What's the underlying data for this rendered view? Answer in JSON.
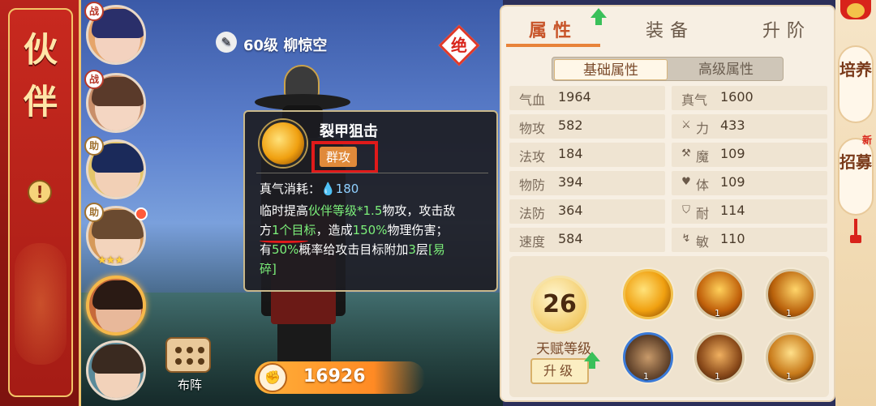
{
  "banner": {
    "title": "伙伴",
    "alert_icon": "exclamation-icon",
    "alert_text": "!"
  },
  "roster": [
    {
      "tag": "战",
      "tag_type": "battle",
      "hair": "#2a2f6a",
      "face": "#f3d2bf",
      "bg": "#e6a56a"
    },
    {
      "tag": "战",
      "tag_type": "battle",
      "hair": "#5a3a2a",
      "face": "#f4d6c2",
      "bg": "#c98f6a"
    },
    {
      "tag": "助",
      "tag_type": "assist",
      "hair": "#1b2a5a",
      "face": "#f2d0b6",
      "bg": "#e4c56a"
    },
    {
      "tag": "助",
      "tag_type": "assist",
      "hair": "#6a4a30",
      "face": "#f3d4bc",
      "bg": "#d69a5a",
      "red_dot": true,
      "stars": "★★★"
    },
    {
      "tag": "",
      "tag_type": "none",
      "hair": "#2a1a14",
      "face": "#e8b89a",
      "bg": "#c76a3a",
      "selected": true
    },
    {
      "tag": "",
      "tag_type": "none",
      "hair": "#3a2a20",
      "face": "#f2d2ba",
      "bg": "#5a8a9a"
    }
  ],
  "hero": {
    "level_name": "60级 柳惊空",
    "rarity": "绝",
    "quill_icon": "quill-icon"
  },
  "formation": {
    "label": "布阵"
  },
  "power": {
    "value": "16926",
    "icon": "fist-icon"
  },
  "skill_tooltip": {
    "name": "裂甲狙击",
    "type": "群攻",
    "cost_label": "真气消耗：",
    "cost_value": "180",
    "desc_1a": "临时提高",
    "desc_1b": "伙伴等级*1.5",
    "desc_1c": "物攻，攻击敌",
    "desc_2a": "方",
    "desc_2b": "1个目标",
    "desc_2c": "，造成",
    "desc_2d": "150%",
    "desc_2e": "物理伤害；",
    "desc_3a": "有",
    "desc_3b": "50%",
    "desc_3c": "概率给攻击目标附加",
    "desc_3d": "3",
    "desc_3e": "层",
    "desc_3f": "[易",
    "desc_4a": "碎]"
  },
  "tabs": [
    {
      "label": "属性",
      "active": true
    },
    {
      "label": "装备",
      "active": false
    },
    {
      "label": "升阶",
      "active": false
    }
  ],
  "attr_modes": [
    {
      "label": "基础属性",
      "active": true
    },
    {
      "label": "高级属性",
      "active": false
    }
  ],
  "attributes_left": [
    {
      "label": "气血",
      "value": "1964"
    },
    {
      "label": "物攻",
      "value": "582"
    },
    {
      "label": "法攻",
      "value": "184"
    },
    {
      "label": "物防",
      "value": "394"
    },
    {
      "label": "法防",
      "value": "364"
    },
    {
      "label": "速度",
      "value": "584"
    }
  ],
  "attributes_right": [
    {
      "label": "真气",
      "value": "1600",
      "icon": ""
    },
    {
      "label": "力",
      "value": "433",
      "icon": "sword-icon"
    },
    {
      "label": "魔",
      "value": "109",
      "icon": "staff-icon"
    },
    {
      "label": "体",
      "value": "109",
      "icon": "heart-icon"
    },
    {
      "label": "耐",
      "value": "114",
      "icon": "shield-icon"
    },
    {
      "label": "敏",
      "value": "110",
      "icon": "boot-icon"
    }
  ],
  "talent": {
    "level": "26",
    "label": "天赋等级",
    "upgrade": "升级"
  },
  "skills": [
    {
      "level": "",
      "style": "active"
    },
    {
      "level": "1",
      "style": "normal"
    },
    {
      "level": "1",
      "style": "normal"
    },
    {
      "level": "1",
      "style": "blue"
    },
    {
      "level": "1",
      "style": "normal"
    },
    {
      "level": "1",
      "style": "normal"
    }
  ],
  "side_buttons": [
    {
      "label": "培养",
      "new": ""
    },
    {
      "label": "招募",
      "new": "新"
    }
  ],
  "colors": {
    "accent": "#e8833a",
    "banner_red": "#b9231c",
    "tooltip_highlight": "#7cf07a",
    "box_red": "#e01a1a"
  }
}
